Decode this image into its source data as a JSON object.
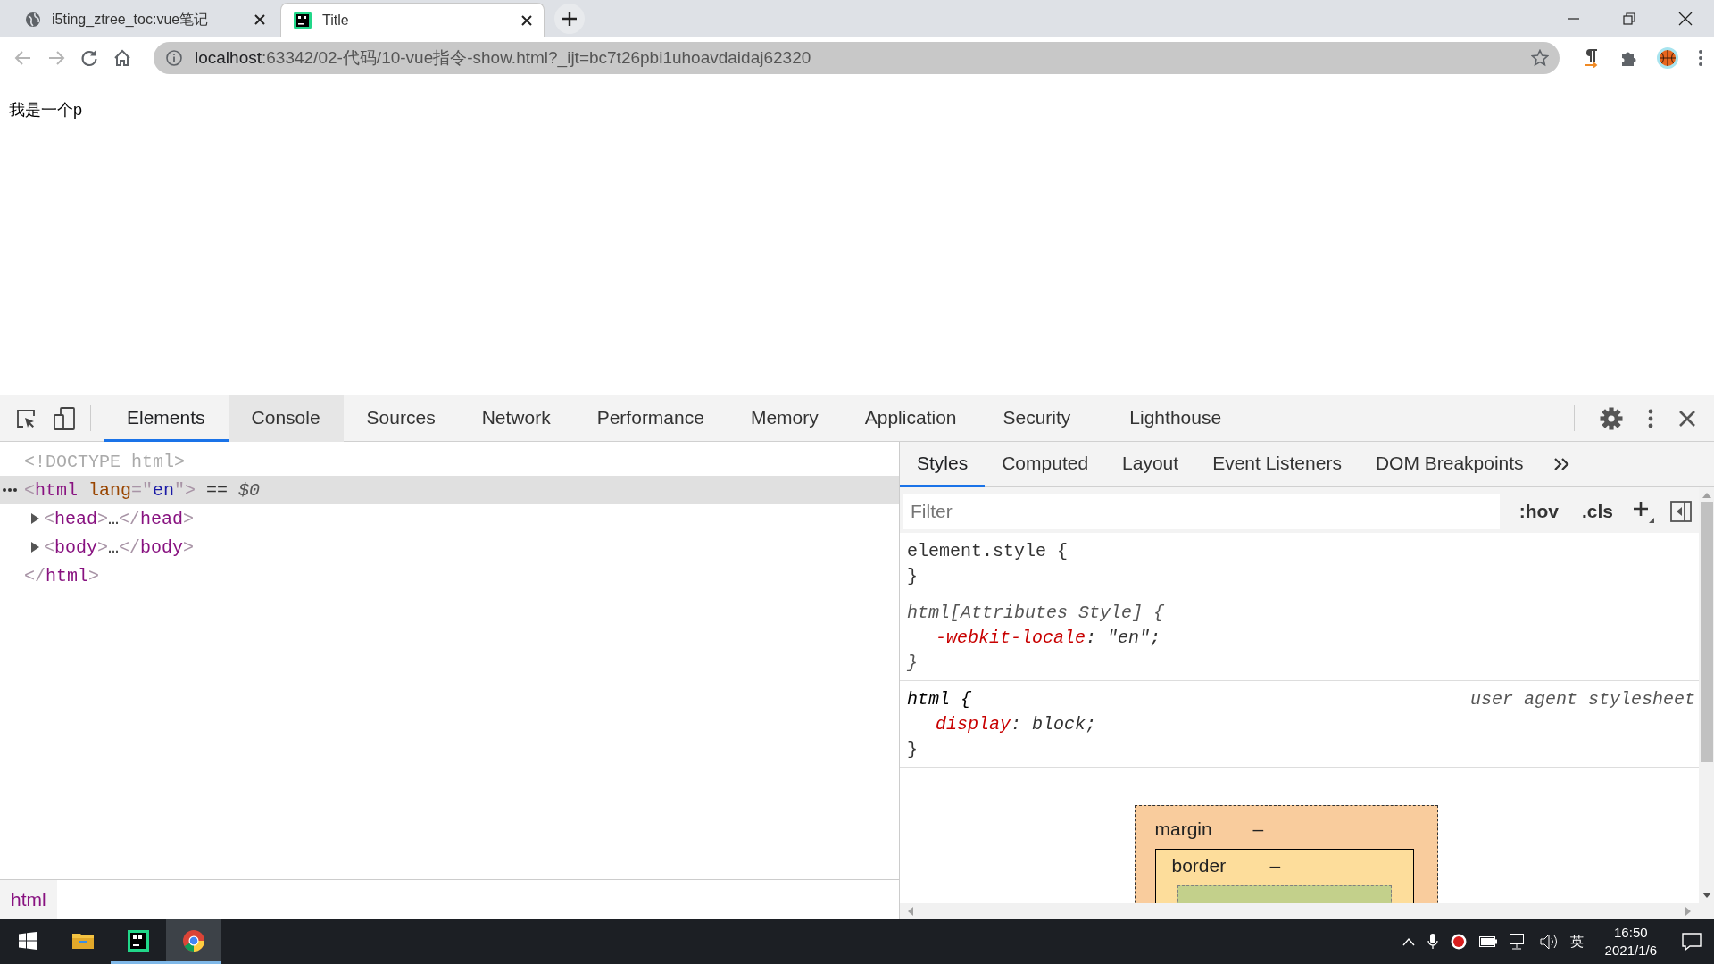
{
  "browser_tabs": [
    {
      "title": "i5ting_ztree_toc:vue笔记",
      "selected": false
    },
    {
      "title": "Title",
      "selected": true
    }
  ],
  "nav": {
    "back": {
      "disabled": true
    },
    "forward": {
      "disabled": true
    }
  },
  "address_bar": {
    "host": "localhost",
    "path": ":63342/02-代码/10-vue指令-show.html?_ijt=bc7t26pbi1uhoavdaidaj62320"
  },
  "page": {
    "paragraph": "我是一个p"
  },
  "devtools": {
    "tabs": [
      {
        "label": "Elements",
        "selected": true,
        "hovered": false
      },
      {
        "label": "Console",
        "selected": false,
        "hovered": true
      },
      {
        "label": "Sources",
        "selected": false,
        "hovered": false
      },
      {
        "label": "Network",
        "selected": false,
        "hovered": false
      },
      {
        "label": "Performance",
        "selected": false,
        "hovered": false
      },
      {
        "label": "Memory",
        "selected": false,
        "hovered": false
      },
      {
        "label": "Application",
        "selected": false,
        "hovered": false
      },
      {
        "label": "Security",
        "selected": false,
        "hovered": false
      },
      {
        "label": "Lighthouse",
        "selected": false,
        "hovered": false
      }
    ],
    "dom_tree": [
      {
        "tokens": [
          {
            "kind": "dim",
            "text": "<!DOCTYPE html>"
          }
        ],
        "selected": false
      },
      {
        "tokens": [
          {
            "kind": "bracket",
            "text": "<"
          },
          {
            "kind": "tag",
            "text": "html"
          },
          {
            "kind": "attr",
            "text": " lang"
          },
          {
            "kind": "bracket",
            "text": "=\""
          },
          {
            "kind": "value",
            "text": "en"
          },
          {
            "kind": "bracket",
            "text": "\">"
          },
          {
            "kind": "plain",
            "text": " == "
          },
          {
            "kind": "ref",
            "text": "$0"
          }
        ],
        "selected": true,
        "expanded": true,
        "children": [
          {
            "tokens": [
              {
                "kind": "bracket",
                "text": "<"
              },
              {
                "kind": "tag",
                "text": "head"
              },
              {
                "kind": "bracket",
                "text": ">"
              },
              {
                "kind": "plain",
                "text": "…"
              },
              {
                "kind": "bracket",
                "text": "</"
              },
              {
                "kind": "tag",
                "text": "head"
              },
              {
                "kind": "bracket",
                "text": ">"
              }
            ],
            "selected": false,
            "expanded": false
          },
          {
            "tokens": [
              {
                "kind": "bracket",
                "text": "<"
              },
              {
                "kind": "tag",
                "text": "body"
              },
              {
                "kind": "bracket",
                "text": ">"
              },
              {
                "kind": "plain",
                "text": "…"
              },
              {
                "kind": "bracket",
                "text": "</"
              },
              {
                "kind": "tag",
                "text": "body"
              },
              {
                "kind": "bracket",
                "text": ">"
              }
            ],
            "selected": false,
            "expanded": false
          }
        ],
        "closing": [
          {
            "kind": "bracket",
            "text": "</"
          },
          {
            "kind": "tag",
            "text": "html"
          },
          {
            "kind": "bracket",
            "text": ">"
          }
        ]
      }
    ],
    "styles_tabs": [
      {
        "label": "Styles",
        "selected": true
      },
      {
        "label": "Computed",
        "selected": false
      },
      {
        "label": "Layout",
        "selected": false
      },
      {
        "label": "Event Listeners",
        "selected": false
      },
      {
        "label": "DOM Breakpoints",
        "selected": false
      }
    ],
    "filter": {
      "placeholder": "Filter"
    },
    "style_buttons": [
      ":hov",
      ".cls"
    ],
    "rules": [
      {
        "kind": "inline",
        "selector": "element.style {",
        "close": "}"
      },
      {
        "kind": "attributes",
        "selector": "html[Attributes Style] {",
        "declarations": [
          {
            "property": "-webkit-locale",
            "rest": ": \"en\";"
          }
        ],
        "close": "}"
      },
      {
        "kind": "user-agent",
        "selector": "html {",
        "source": "user agent stylesheet",
        "declarations": [
          {
            "property": "display",
            "rest": ": block;"
          }
        ],
        "close": "}"
      }
    ],
    "box_model": {
      "margin": {
        "label": "margin",
        "value": "–"
      },
      "border": {
        "label": "border",
        "value": "–"
      }
    },
    "breadcrumb": "html"
  },
  "taskbar": {
    "apps": [
      {
        "running": false,
        "selected": false
      },
      {
        "running": true,
        "selected": false
      },
      {
        "running": true,
        "selected": true
      }
    ],
    "ime": "英",
    "time": "16:50",
    "date": "2021/1/6"
  }
}
